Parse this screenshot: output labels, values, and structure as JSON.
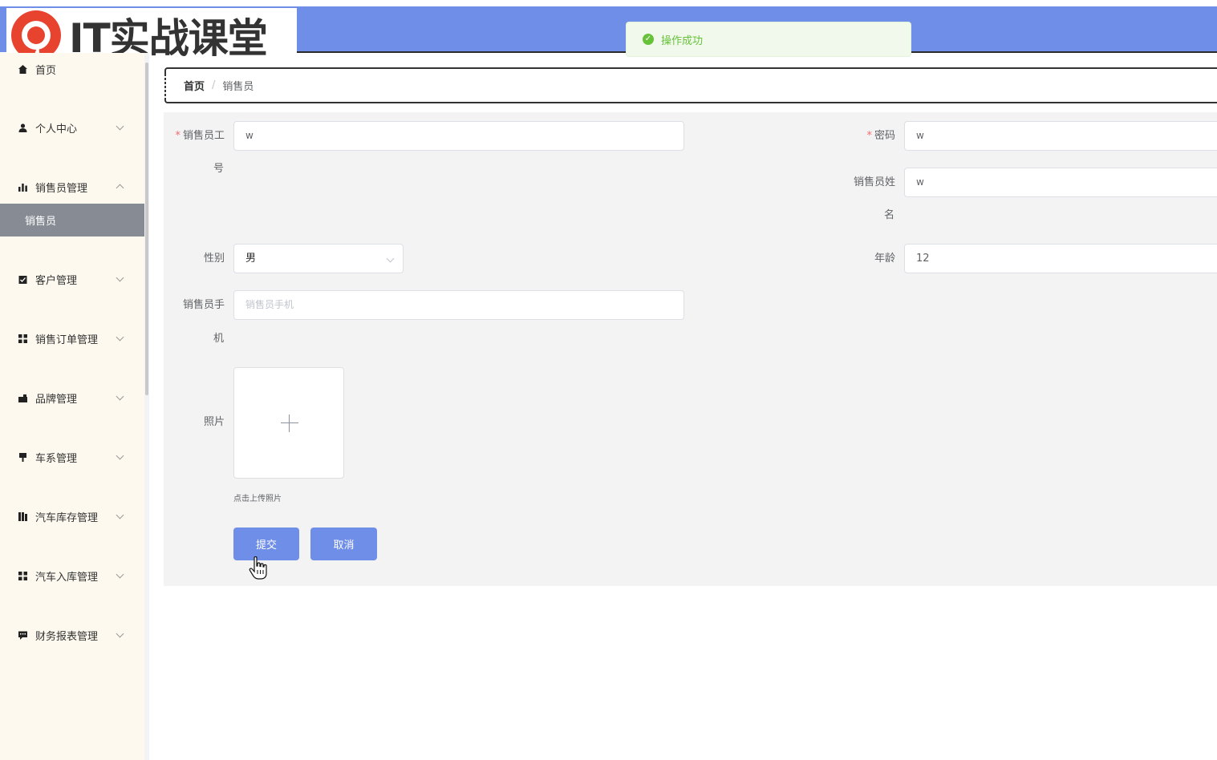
{
  "logo": {
    "text": "IT实战课堂",
    "mark_color": "#e8432e"
  },
  "toast": {
    "message": "操作成功",
    "icon": "check-circle-icon",
    "color": "#67c23a"
  },
  "sidebar": {
    "items": [
      {
        "label": "首页",
        "icon": "home-icon",
        "expandable": false
      },
      {
        "label": "个人中心",
        "icon": "user-icon",
        "expandable": true
      },
      {
        "label": "销售员管理",
        "icon": "bar-chart-icon",
        "expandable": true
      },
      {
        "label": "客户管理",
        "icon": "clipboard-icon",
        "expandable": true
      },
      {
        "label": "销售订单管理",
        "icon": "grid-icon",
        "expandable": true
      },
      {
        "label": "品牌管理",
        "icon": "tag-icon",
        "expandable": true
      },
      {
        "label": "车系管理",
        "icon": "bookmark-icon",
        "expandable": true
      },
      {
        "label": "汽车库存管理",
        "icon": "book-icon",
        "expandable": true
      },
      {
        "label": "汽车入库管理",
        "icon": "grid-icon",
        "expandable": true
      },
      {
        "label": "财务报表管理",
        "icon": "message-icon",
        "expandable": true
      }
    ],
    "active_sub": "销售员"
  },
  "breadcrumb": {
    "home": "首页",
    "separator": "/",
    "current": "销售员"
  },
  "form": {
    "id_label_1": "销售员工",
    "id_label_2": "号",
    "id_value": "w",
    "password_label": "密码",
    "password_value": "w",
    "name_label_1": "销售员姓",
    "name_label_2": "名",
    "name_value": "w",
    "gender_label": "性别",
    "gender_value": "男",
    "age_label": "年龄",
    "age_value": "12",
    "phone_label_1": "销售员手",
    "phone_label_2": "机",
    "phone_placeholder": "销售员手机",
    "photo_label": "照片",
    "upload_tip": "点击上传照片",
    "required_mark": "*"
  },
  "buttons": {
    "submit": "提交",
    "cancel": "取消"
  },
  "colors": {
    "primary": "#6f8ee8",
    "sidebar_bg": "#fdf9ef",
    "active_bg": "#878c94"
  }
}
